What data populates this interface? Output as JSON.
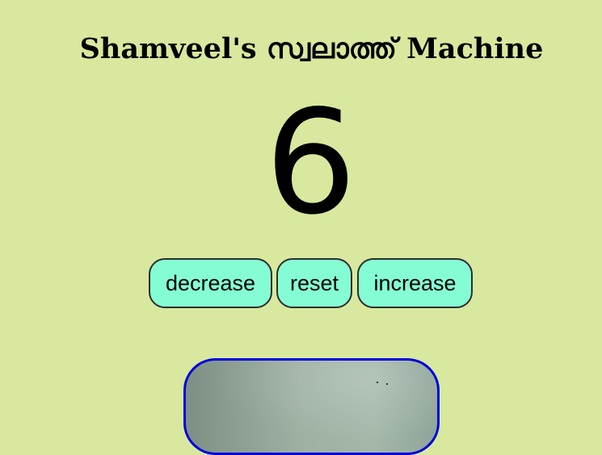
{
  "app": {
    "title": "Shamveel's സ്വലാത്ത് Machine"
  },
  "counter": {
    "value": "6"
  },
  "buttons": {
    "decrease_label": "decrease",
    "reset_label": "reset",
    "increase_label": "increase"
  },
  "colors": {
    "background": "#d8e89e",
    "button_fill": "#85fdd4",
    "button_border": "#2d2d2d",
    "image_border": "#0000dd"
  }
}
